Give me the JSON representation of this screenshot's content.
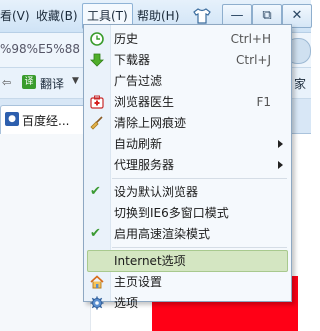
{
  "menubar": {
    "items": [
      "看(V)",
      "收藏(B)",
      "工具(T)",
      "帮助(H)"
    ]
  },
  "window_buttons": [
    "—",
    "⧉",
    "✕"
  ],
  "address_bar": {
    "text": "%98%E5%88"
  },
  "toolbar": {
    "translate_label": "翻译",
    "right_text": "家"
  },
  "tab": {
    "label": "百度经..."
  },
  "menu": {
    "items": [
      {
        "label": "历史",
        "shortcut": "Ctrl+H",
        "icon": "clock-icon"
      },
      {
        "label": "下载器",
        "shortcut": "Ctrl+J",
        "icon": "download-arrow-icon"
      },
      {
        "label": "广告过滤",
        "shortcut": "",
        "icon": ""
      },
      {
        "label": "浏览器医生",
        "shortcut": "F1",
        "icon": "first-aid-icon"
      },
      {
        "label": "清除上网痕迹",
        "shortcut": "",
        "icon": "broom-icon"
      },
      {
        "label": "自动刷新",
        "shortcut": "",
        "icon": "",
        "submenu": true
      },
      {
        "label": "代理服务器",
        "shortcut": "",
        "icon": "",
        "submenu": true
      },
      {
        "label": "设为默认浏览器",
        "shortcut": "",
        "icon": "checkmark-icon"
      },
      {
        "label": "切换到IE6多窗口模式",
        "shortcut": "",
        "icon": ""
      },
      {
        "label": "启用高速渲染模式",
        "shortcut": "",
        "icon": "checkmark-icon"
      },
      {
        "label": "Internet选项",
        "shortcut": "",
        "icon": "",
        "highlighted": true
      },
      {
        "label": "主页设置",
        "shortcut": "",
        "icon": "house-icon"
      },
      {
        "label": "选项",
        "shortcut": "",
        "icon": "gear-icon"
      }
    ]
  },
  "colors": {
    "highlight": "#d4e6c2",
    "check": "#3b9a32",
    "redaction": "#ff0016"
  }
}
